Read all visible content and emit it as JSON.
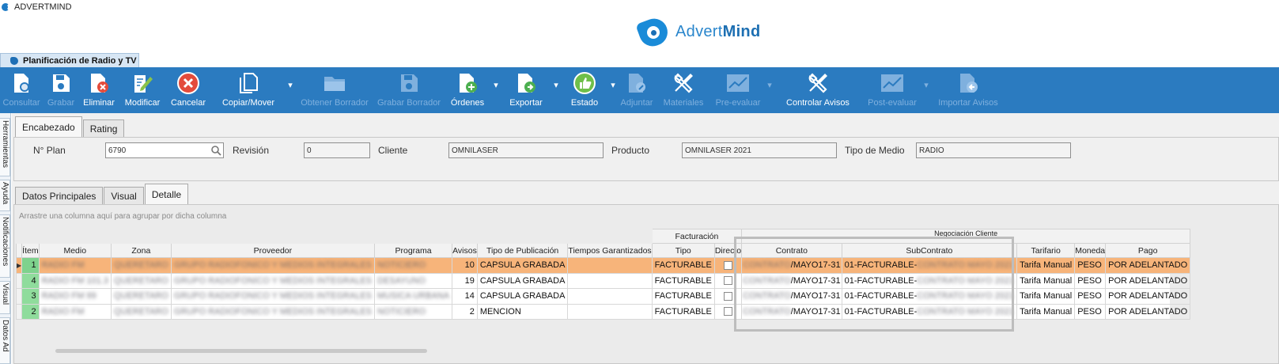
{
  "window": {
    "title": "ADVERTMIND"
  },
  "brand": {
    "name_regular": "Advert",
    "name_bold": "Mind"
  },
  "document_tab": {
    "label": "Planificación de Radio y TV"
  },
  "toolbar": {
    "buttons": [
      {
        "label": "Consultar",
        "icon": "consult-icon",
        "enabled": false
      },
      {
        "label": "Grabar",
        "icon": "save-icon",
        "enabled": false
      },
      {
        "label": "Eliminar",
        "icon": "delete-doc-icon",
        "enabled": true
      },
      {
        "label": "Modificar",
        "icon": "edit-icon",
        "enabled": true
      },
      {
        "label": "Cancelar",
        "icon": "cancel-icon",
        "enabled": true
      },
      {
        "label": "Copiar/Mover",
        "icon": "copy-icon",
        "enabled": true,
        "dropdown": true
      },
      {
        "label": "Obtener Borrador",
        "icon": "folder-icon",
        "enabled": false
      },
      {
        "label": "Grabar Borrador",
        "icon": "save-draft-icon",
        "enabled": false
      },
      {
        "label": "Órdenes",
        "icon": "orders-icon",
        "enabled": true,
        "dropdown": true
      },
      {
        "label": "Exportar",
        "icon": "export-icon",
        "enabled": true,
        "dropdown": true
      },
      {
        "label": "Estado",
        "icon": "thumbs-up-icon",
        "enabled": true,
        "dropdown": true
      },
      {
        "label": "Adjuntar",
        "icon": "attach-icon",
        "enabled": false
      },
      {
        "label": "Materiales",
        "icon": "tools-icon",
        "enabled": false
      },
      {
        "label": "Pre-evaluar",
        "icon": "chart-icon",
        "enabled": false,
        "dropdown": true
      },
      {
        "label": "Controlar Avisos",
        "icon": "tools-icon",
        "enabled": true
      },
      {
        "label": "Post-evaluar",
        "icon": "chart-icon",
        "enabled": false,
        "dropdown": true
      },
      {
        "label": "Importar Avisos",
        "icon": "import-icon",
        "enabled": false
      }
    ]
  },
  "side_tabs": [
    "Herramientas",
    "Ayuda",
    "Notificaciones",
    "Visual",
    "Datos Ad"
  ],
  "header_tabs": [
    {
      "label": "Encabezado",
      "active": true
    },
    {
      "label": "Rating",
      "active": false
    }
  ],
  "header": {
    "plan_label": "N° Plan",
    "plan_value": "6790",
    "revision_label": "Revisión",
    "revision_value": "0",
    "cliente_label": "Cliente",
    "cliente_value": "OMNILASER",
    "producto_label": "Producto",
    "producto_value": "OMNILASER 2021",
    "tipo_medio_label": "Tipo de Medio",
    "tipo_medio_value": "RADIO"
  },
  "detail_tabs": [
    {
      "label": "Datos Principales",
      "active": false
    },
    {
      "label": "Visual",
      "active": false
    },
    {
      "label": "Detalle",
      "active": true
    }
  ],
  "grid": {
    "group_hint": "Arrastre una columna aquí para agrupar por dicha columna",
    "band_facturacion": "Facturación",
    "band_negociacion": "Negociación Cliente",
    "columns": [
      "Ítem",
      "Medio",
      "Zona",
      "Proveedor",
      "Programa",
      "Avisos",
      "Tipo de Publicación",
      "Tiempos Garantizados",
      "Tipo",
      "Directo",
      "Contrato",
      "SubContrato",
      "Tarifario",
      "Moneda",
      "Pago"
    ],
    "rows": [
      {
        "item": "1",
        "medio": "RADIO FM",
        "zona": "QUERETARO",
        "proveedor": "GRUPO RADIOFONICO Y MEDIOS INTEGRALES",
        "programa": "NOTICIERO",
        "avisos": "10",
        "tipo_pub": "CAPSULA GRABADA",
        "tiempos": "",
        "tipo": "FACTURABLE",
        "contrato_hidden": "CONTRATO",
        "contrato": "/MAYO17-31",
        "subcontrato": "01-FACTURABLE-",
        "subcontrato_hidden": "CONTRATO MAYO 2021",
        "tarifario": "Tarifa Manual",
        "moneda": "PESO",
        "pago": "POR ADELANTADO"
      },
      {
        "item": "4",
        "medio": "RADIO FM 101.3",
        "zona": "QUERETARO",
        "proveedor": "GRUPO RADIOFONICO Y MEDIOS INTEGRALES",
        "programa": "DESAYUNO",
        "avisos": "19",
        "tipo_pub": "CAPSULA GRABADA",
        "tiempos": "",
        "tipo": "FACTURABLE",
        "contrato_hidden": "CONTRATO",
        "contrato": "/MAYO17-31",
        "subcontrato": "01-FACTURABLE-",
        "subcontrato_hidden": "CONTRATO MAYO 2021",
        "tarifario": "Tarifa Manual",
        "moneda": "PESO",
        "pago": "POR ADELANTADO"
      },
      {
        "item": "3",
        "medio": "RADIO FM 99",
        "zona": "QUERETARO",
        "proveedor": "GRUPO RADIOFONICO Y MEDIOS INTEGRALES",
        "programa": "MUSICA URBANA",
        "avisos": "14",
        "tipo_pub": "CAPSULA GRABADA",
        "tiempos": "",
        "tipo": "FACTURABLE",
        "contrato_hidden": "CONTRATO",
        "contrato": "/MAYO17-31",
        "subcontrato": "01-FACTURABLE-",
        "subcontrato_hidden": "CONTRATO MAYO 2021",
        "tarifario": "Tarifa Manual",
        "moneda": "PESO",
        "pago": "POR ADELANTADO"
      },
      {
        "item": "2",
        "medio": "RADIO FM",
        "zona": "QUERETARO",
        "proveedor": "GRUPO RADIOFONICO Y MEDIOS INTEGRALES",
        "programa": "NOTICIERO",
        "avisos": "2",
        "tipo_pub": "MENCION",
        "tiempos": "",
        "tipo": "FACTURABLE",
        "contrato_hidden": "CONTRATO",
        "contrato": "/MAYO17-31",
        "subcontrato": "01-FACTURABLE-",
        "subcontrato_hidden": "CONTRATO MAYO 2021",
        "tarifario": "Tarifa Manual",
        "moneda": "PESO",
        "pago": "POR ADELANTADO"
      }
    ]
  },
  "colors": {
    "toolbar_bg": "#2b7bc0",
    "selected_row": "#f7b47a",
    "item_cell": "#8fdc9c",
    "brand": "#1a8bd8"
  }
}
